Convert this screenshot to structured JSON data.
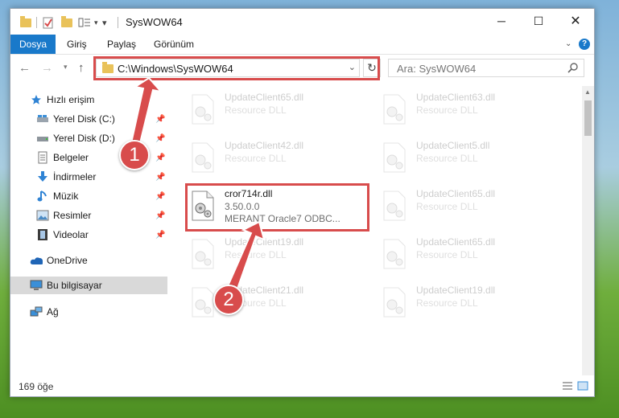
{
  "window": {
    "title": "SysWOW64"
  },
  "ribbon": {
    "tabs": [
      "Dosya",
      "Giriş",
      "Paylaş",
      "Görünüm"
    ]
  },
  "nav": {
    "address": "C:\\Windows\\SysWOW64",
    "search_placeholder": "Ara: SysWOW64"
  },
  "sidebar": {
    "items": [
      {
        "label": "Hızlı erişim",
        "icon": "star-icon"
      },
      {
        "label": "Yerel Disk (C:)",
        "icon": "drive-icon"
      },
      {
        "label": "Yerel Disk (D:)",
        "icon": "drive-icon"
      },
      {
        "label": "Belgeler",
        "icon": "documents-icon"
      },
      {
        "label": "İndirmeler",
        "icon": "download-icon"
      },
      {
        "label": "Müzik",
        "icon": "music-icon"
      },
      {
        "label": "Resimler",
        "icon": "pictures-icon"
      },
      {
        "label": "Videolar",
        "icon": "video-icon"
      },
      {
        "label": "OneDrive",
        "icon": "cloud-icon"
      },
      {
        "label": "Bu bilgisayar",
        "icon": "computer-icon"
      },
      {
        "label": "Ağ",
        "icon": "network-icon"
      }
    ]
  },
  "files": {
    "left": [
      {
        "name": "UpdateClient65.dll",
        "desc": "Resource DLL"
      },
      {
        "name": "UpdateClient42.dll",
        "desc": "Resource DLL"
      },
      {
        "name": "cror714r.dll",
        "desc": "3.50.0.0",
        "desc2": "MERANT Oracle7 ODBC..."
      },
      {
        "name": "UpdateClient19.dll",
        "desc": "Resource DLL"
      },
      {
        "name": "UpdateClient21.dll",
        "desc": "Resource DLL"
      }
    ],
    "right": [
      {
        "name": "UpdateClient63.dll",
        "desc": "Resource DLL"
      },
      {
        "name": "UpdateClient5.dll",
        "desc": "Resource DLL"
      },
      {
        "name": "UpdateClient65.dll",
        "desc": "Resource DLL"
      },
      {
        "name": "UpdateClient65.dll",
        "desc": "Resource DLL"
      },
      {
        "name": "UpdateClient19.dll",
        "desc": "Resource DLL"
      }
    ]
  },
  "status": {
    "count": "169 öğe"
  },
  "callouts": [
    "1",
    "2"
  ],
  "colors": {
    "accent": "#1979ca",
    "highlight": "#d84c4c"
  }
}
